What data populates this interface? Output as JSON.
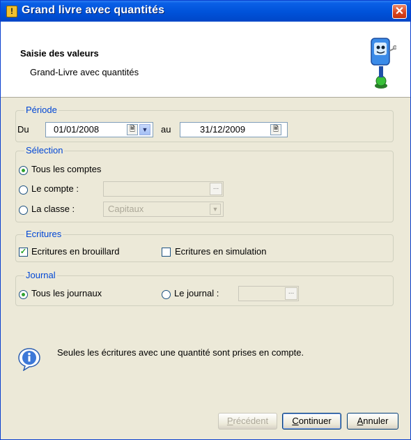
{
  "window": {
    "title": "Grand livre avec quantités",
    "close_label": "✕"
  },
  "header": {
    "title": "Saisie des valeurs",
    "subtitle": "Grand-Livre avec quantités"
  },
  "periode": {
    "legend": "Période",
    "du_label": "Du",
    "date_from": "01/01/2008",
    "au_label": "au",
    "date_to": "31/12/2009"
  },
  "selection": {
    "legend": "Sélection",
    "option_all": "Tous les comptes",
    "option_account": "Le compte :",
    "account_value": "",
    "option_class": "La classe :",
    "class_value": "Capitaux",
    "selected": "Tous les comptes"
  },
  "ecritures": {
    "legend": "Ecritures",
    "draft_label": "Ecritures en brouillard",
    "draft_checked": true,
    "simulation_label": "Ecritures en simulation",
    "simulation_checked": false
  },
  "journal": {
    "legend": "Journal",
    "option_all": "Tous les journaux",
    "option_journal": "Le journal :",
    "journal_value": "",
    "selected": "Tous les journaux"
  },
  "info": {
    "message": "Seules les écritures avec une quantité sont prises en compte."
  },
  "buttons": {
    "previous_first": "P",
    "previous_rest": "récédent",
    "continue_first": "C",
    "continue_rest": "ontinuer",
    "cancel_first": "A",
    "cancel_rest": "nnuler"
  },
  "colors": {
    "titlebar": "#0052d9",
    "dialog_bg": "#ece9d8",
    "group_label": "#0046d5",
    "check_mark": "#21a121"
  },
  "icons": {
    "title": "warning-app-icon",
    "wizard": "wizard-mascot-icon",
    "info": "info-bubble-icon",
    "date": "calendar-icon",
    "dropdown": "chevron-down-icon",
    "ellipsis": "ellipsis-icon"
  }
}
